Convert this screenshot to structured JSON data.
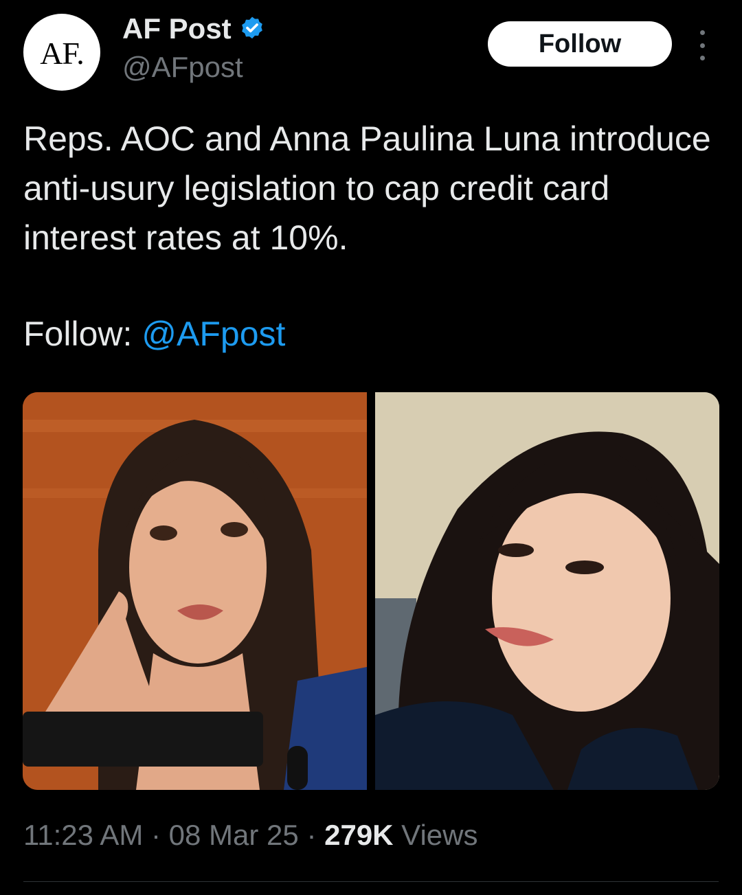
{
  "author": {
    "avatar_text": "AF.",
    "name": "AF Post",
    "handle": "@AFpost",
    "verified": true
  },
  "follow_button": {
    "label": "Follow"
  },
  "more_icon": "more-vertical-icon",
  "tweet": {
    "text": "Reps. AOC and Anna Paulina Luna introduce anti-usury legislation to cap credit card interest rates at 10%.",
    "follow_prefix": "Follow:",
    "follow_mention": "@AFpost"
  },
  "meta": {
    "time": "11:23 AM",
    "sep1": " · ",
    "date": "08 Mar 25",
    "sep2": " · ",
    "views_count": "279K",
    "views_label": " Views"
  },
  "colors": {
    "background": "#000000",
    "text": "#e7e9ea",
    "muted": "#71767b",
    "link": "#1d9bf0",
    "verified": "#1d9bf0"
  }
}
